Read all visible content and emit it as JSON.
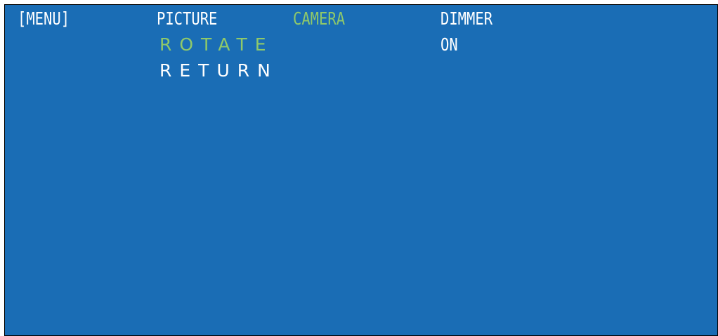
{
  "menu": {
    "title": "[MENU]",
    "tabs": [
      {
        "label": "PICTURE",
        "selected": false
      },
      {
        "label": "CAMERA",
        "selected": true
      },
      {
        "label": "DIMMER",
        "selected": false
      }
    ]
  },
  "camera_menu": {
    "items": [
      {
        "label": "ROTATE",
        "value": "ON",
        "highlighted": true
      },
      {
        "label": "RETURN",
        "highlighted": false
      }
    ]
  },
  "colors": {
    "background": "#1a6db5",
    "text": "#ffffff",
    "highlight": "#8fc96a",
    "frame": "#000000"
  }
}
